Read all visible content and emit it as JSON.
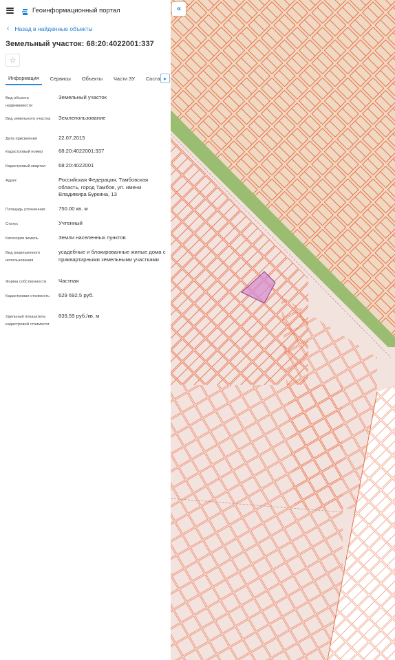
{
  "app": {
    "title": "Геоинформационный портал"
  },
  "nav": {
    "back_label": "Назад в найденные объекты"
  },
  "object": {
    "title": "Земельный участок: 68:20:4022001:337"
  },
  "tabs": [
    {
      "label": "Информация",
      "active": true
    },
    {
      "label": "Сервисы",
      "active": false
    },
    {
      "label": "Объекты",
      "active": false
    },
    {
      "label": "Части ЗУ",
      "active": false
    },
    {
      "label": "Состав",
      "active": false
    }
  ],
  "info": [
    {
      "label": "Вид объекта недвижимости",
      "value": "Земельный участок"
    },
    {
      "label": "Вид земельного участка",
      "value": "Землепользование"
    },
    {
      "label": "Дата присвоения",
      "value": "22.07.2015"
    },
    {
      "label": "Кадастровый номер",
      "value": "68:20:4022001:337"
    },
    {
      "label": "Кадастровый квартал",
      "value": "68:20:4022001"
    },
    {
      "label": "Адрес",
      "value": "Российская Федерация, Тамбовская область, город Тамбов, ул. имени Владимира Буркина, 13"
    },
    {
      "label": "Площадь уточненная",
      "value": "750.00 кв. м"
    },
    {
      "label": "Статус",
      "value": "Учтенный"
    },
    {
      "label": "Категория земель",
      "value": "Земли населенных пунктов"
    },
    {
      "label": "Вид разрешенного использования",
      "value": "усадебные и блокированные жилые дома с приквартирными земельными участками"
    },
    {
      "label": "Форма собственности",
      "value": "Частная"
    },
    {
      "label": "Кадастровая стоимость",
      "value": "629 692,5 руб."
    },
    {
      "label": "Удельный показатель кадастровой стоимости",
      "value": "839,59 руб./кв. м"
    }
  ],
  "icons": {
    "menu": "hamburger-icon",
    "logo": "portal-logo-icon",
    "back": "chevron-left-icon",
    "favorite": "star-outline-icon",
    "tabs_next": "chevron-right-icon",
    "collapse": "double-chevron-left-icon"
  },
  "colors": {
    "accent": "#1e7dd2",
    "map_background": "#f3e3df",
    "parcel_stroke": "#e8704a",
    "quarter_fill": "#f0d9c3",
    "green_strip": "#9bbd72",
    "selected_parcel": "#d58fd0"
  }
}
